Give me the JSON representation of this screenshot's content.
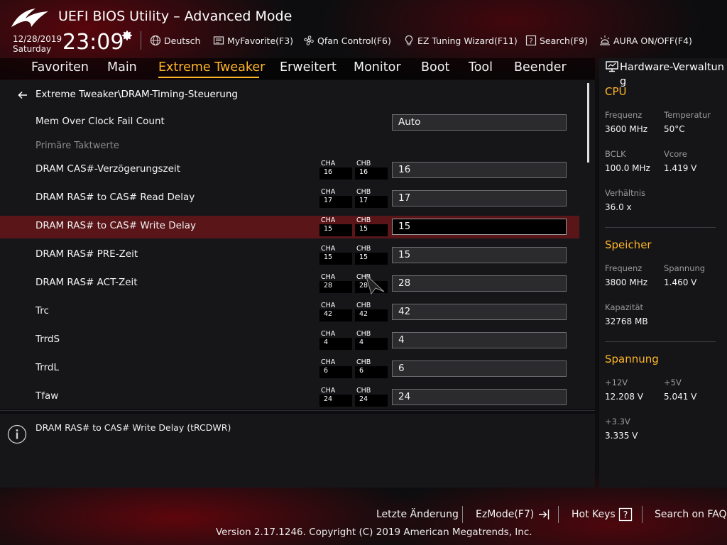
{
  "header": {
    "app_title": "UEFI BIOS Utility – Advanced Mode",
    "date": "12/28/2019",
    "day": "Saturday",
    "time": "23:09",
    "buttons": [
      {
        "label": "Deutsch",
        "icon": "globe-icon"
      },
      {
        "label": "MyFavorite(F3)",
        "icon": "favorites-icon"
      },
      {
        "label": "Qfan Control(F6)",
        "icon": "fan-icon"
      },
      {
        "label": "EZ Tuning Wizard(F11)",
        "icon": "lightbulb-icon"
      },
      {
        "label": "Search(F9)",
        "icon": "help-box-icon"
      },
      {
        "label": "AURA ON/OFF(F4)",
        "icon": "aura-light-icon"
      }
    ]
  },
  "menu": {
    "tabs": [
      "Favoriten",
      "Main",
      "Extreme Tweaker",
      "Erweitert",
      "Monitor",
      "Boot",
      "Tool",
      "Beender"
    ],
    "active": "Extreme Tweaker"
  },
  "breadcrumb": "Extreme Tweaker\\DRAM-Timing-Steuerung",
  "settings": {
    "mem_fail_count": {
      "label": "Mem Over Clock Fail Count",
      "value": "Auto"
    },
    "section_label": "Primäre Taktwerte",
    "cha_label": "CHA",
    "chb_label": "CHB",
    "rows": [
      {
        "label": "DRAM CAS#-Verzögerungszeit",
        "cha": "16",
        "chb": "16",
        "value": "16"
      },
      {
        "label": "DRAM RAS# to CAS# Read Delay",
        "cha": "17",
        "chb": "17",
        "value": "17"
      },
      {
        "label": "DRAM RAS# to CAS# Write Delay",
        "cha": "15",
        "chb": "15",
        "value": "15"
      },
      {
        "label": "DRAM RAS# PRE-Zeit",
        "cha": "15",
        "chb": "15",
        "value": "15"
      },
      {
        "label": "DRAM RAS# ACT-Zeit",
        "cha": "28",
        "chb": "28",
        "value": "28"
      },
      {
        "label": "Trc",
        "cha": "42",
        "chb": "42",
        "value": "42"
      },
      {
        "label": "TrrdS",
        "cha": "4",
        "chb": "4",
        "value": "4"
      },
      {
        "label": "TrrdL",
        "cha": "6",
        "chb": "6",
        "value": "6"
      },
      {
        "label": "Tfaw",
        "cha": "24",
        "chb": "24",
        "value": "24"
      }
    ]
  },
  "help_text": "DRAM RAS# to CAS# Write Delay (tRCDWR)",
  "hardware": {
    "title": "Hardware-Verwaltung",
    "cpu": {
      "title": "CPU",
      "freq_label": "Frequenz",
      "freq": "3600 MHz",
      "temp_label": "Temperatur",
      "temp": "50°C",
      "bclk_label": "BCLK",
      "bclk": "100.0 MHz",
      "vcore_label": "Vcore",
      "vcore": "1.419 V",
      "ratio_label": "Verhältnis",
      "ratio": "36.0 x"
    },
    "memory": {
      "title": "Speicher",
      "freq_label": "Frequenz",
      "freq": "3800 MHz",
      "volt_label": "Spannung",
      "volt": "1.460 V",
      "cap_label": "Kapazität",
      "cap": "32768 MB"
    },
    "voltage": {
      "title": "Spannung",
      "v12_label": "+12V",
      "v12": "12.208 V",
      "v5_label": "+5V",
      "v5": "5.041 V",
      "v33_label": "+3.3V",
      "v33": "3.335 V"
    }
  },
  "footer": {
    "last_change": "Letzte Änderung",
    "ezmode": "EzMode(F7)",
    "hotkeys": "Hot Keys",
    "faq": "Search on FAQ",
    "version": "Version 2.17.1246. Copyright (C) 2019 American Megatrends, Inc."
  },
  "colors": {
    "accent": "#ffb628",
    "highlight": "#5a1518",
    "background": "#0d0d0f"
  }
}
